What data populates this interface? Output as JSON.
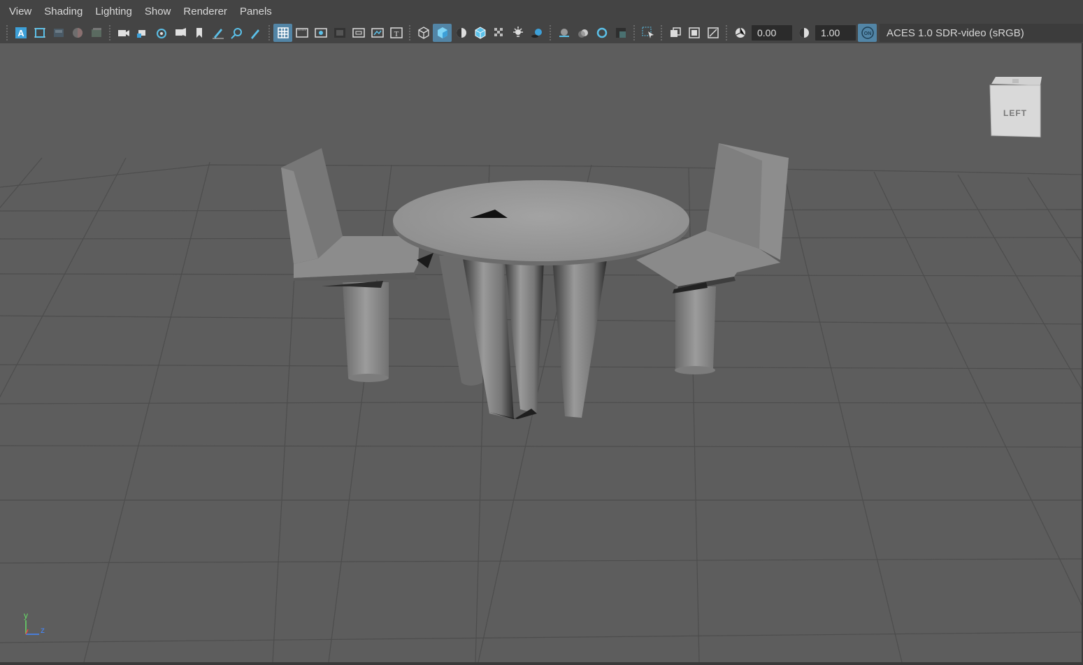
{
  "menu": {
    "items": [
      "View",
      "Shading",
      "Lighting",
      "Show",
      "Renderer",
      "Panels"
    ]
  },
  "toolbar": {
    "exposure_value": "0.00",
    "gamma_value": "1.00",
    "color_management_toggle": "ON",
    "color_space": "ACES 1.0 SDR-video (sRGB)",
    "accent_color": "#5285a6",
    "icons": [
      "select-camera-icon",
      "camera-attributes-icon",
      "bookmarks-icon",
      "image-plane-icon",
      "two-d-pan-zoom-icon",
      "grease-pencil-icon",
      "grid-icon",
      "film-gate-icon",
      "resolution-gate-icon",
      "gate-mask-icon",
      "field-chart-icon",
      "safe-action-icon",
      "safe-title-icon",
      "wireframe-icon",
      "smooth-shade-icon",
      "default-material-icon",
      "wireframe-on-shaded-icon",
      "xray-icon",
      "use-all-lights-icon",
      "shadows-icon",
      "screen-space-ao-icon",
      "motion-blur-icon",
      "multisample-aa-icon",
      "depth-of-field-icon",
      "isolate-select-icon",
      "xray-joints-icon",
      "xray-active-components-icon",
      "backface-culling-icon",
      "exposure-icon",
      "gamma-icon",
      "color-management-icon"
    ]
  },
  "viewport": {
    "view_cube_label": "LEFT",
    "axis_y_label": "y",
    "axis_z_label": "z",
    "background_color": "#5d5d5d"
  }
}
